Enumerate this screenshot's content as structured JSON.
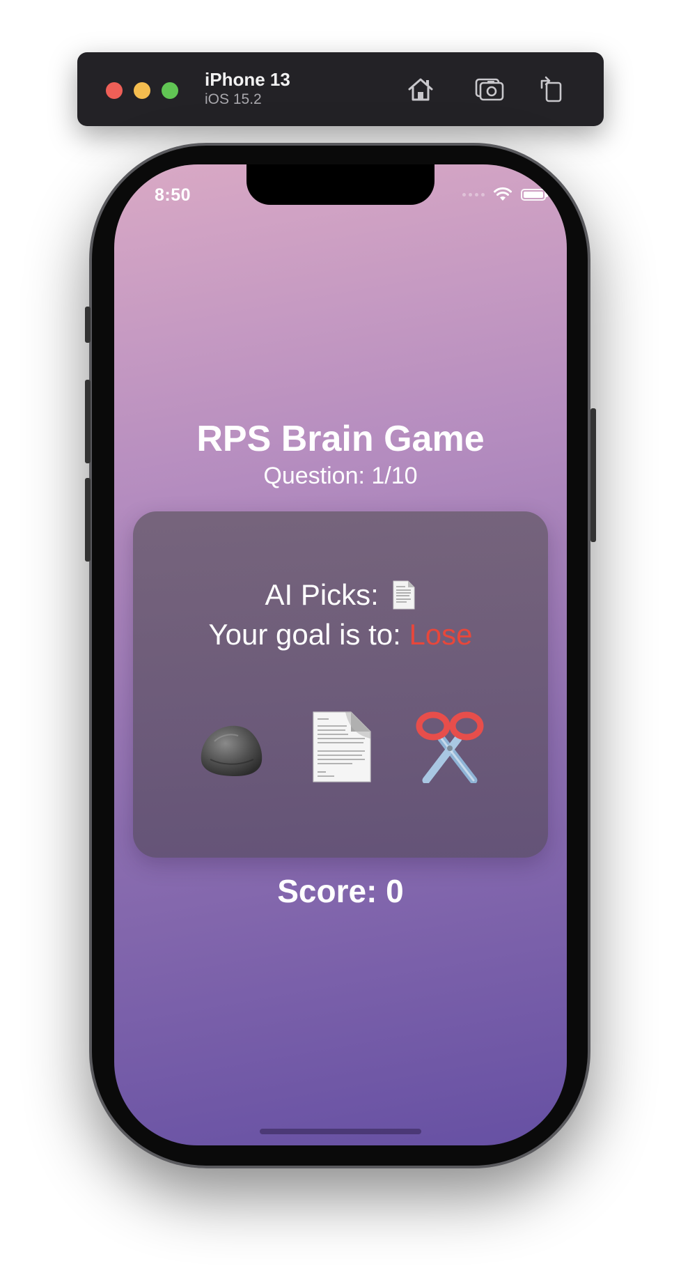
{
  "simulator": {
    "device_name": "iPhone 13",
    "os_version": "iOS 15.2",
    "buttons": [
      "home-icon",
      "screenshot-icon",
      "rotate-icon"
    ]
  },
  "status_bar": {
    "time": "8:50"
  },
  "game": {
    "title": "RPS Brain Game",
    "question": "Question: 1/10",
    "ai_picks_label": "AI Picks:",
    "ai_pick_icon": "paper-document-icon",
    "goal_label": "Your goal is to:",
    "goal_value": "Lose",
    "goal_color": "#e7473b",
    "choices": [
      "rock-icon",
      "paper-icon",
      "scissors-icon"
    ],
    "score": "Score: 0"
  },
  "colors": {
    "gradient_top": "#d9a9c5",
    "gradient_bottom": "#6650a3",
    "card": "#6e5f73"
  }
}
